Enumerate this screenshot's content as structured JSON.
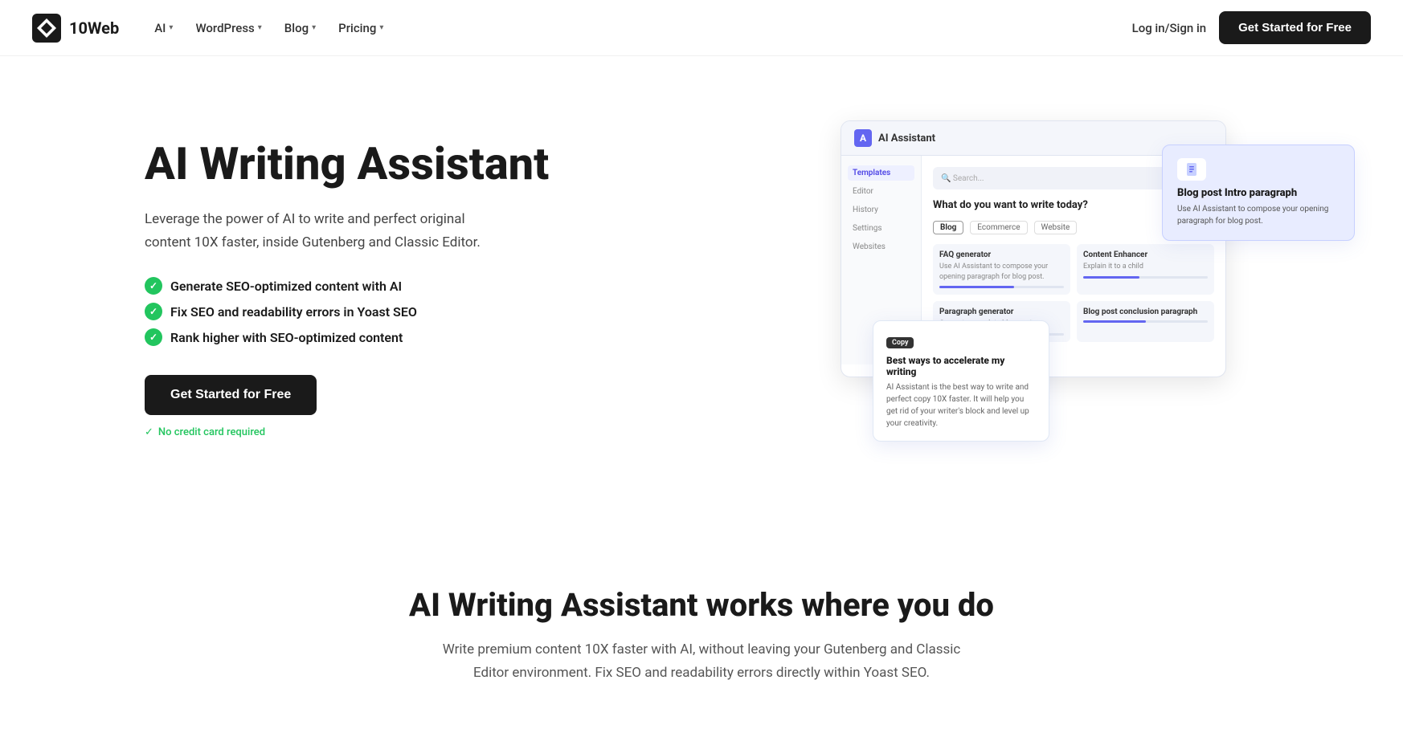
{
  "brand": {
    "name": "10Web",
    "logo_alt": "10Web logo"
  },
  "navbar": {
    "menu": [
      {
        "label": "AI",
        "has_dropdown": true
      },
      {
        "label": "WordPress",
        "has_dropdown": true
      },
      {
        "label": "Blog",
        "has_dropdown": true
      },
      {
        "label": "Pricing",
        "has_dropdown": true
      }
    ],
    "login_label": "Log in/Sign in",
    "cta_label": "Get Started for Free"
  },
  "hero": {
    "title": "AI Writing Assistant",
    "description": "Leverage the power of AI to write and perfect original content 10X faster, inside Gutenberg and Classic Editor.",
    "features": [
      "Generate SEO-optimized content with AI",
      "Fix SEO and readability errors in Yoast SEO",
      "Rank higher with SEO-optimized content"
    ],
    "cta_label": "Get Started for Free",
    "no_cc_label": "No credit card required"
  },
  "mockup": {
    "topbar_title": "AI Assistant",
    "prompt": "What do you want to write today?",
    "search_placeholder": "Search...",
    "sidebar_items": [
      "Templates",
      "Editor",
      "History",
      "Settings",
      "Websites"
    ],
    "tabs": [
      "Blog",
      "Ecommerce",
      "Website"
    ],
    "cards": [
      {
        "title": "FAQ generator",
        "text": "Use AI Assistant to compose your opening paragraph for blog post."
      },
      {
        "title": "Content Enhancer",
        "text": "Explain it to a child"
      },
      {
        "title": "Paragraph generator",
        "text": "Generate complete blog post"
      },
      {
        "title": "Blog post conclusion paragraph",
        "text": ""
      }
    ]
  },
  "floating_card_1": {
    "copy_label": "Copy",
    "title": "Best ways to accelerate my writing",
    "text": "AI Assistant is the best way to write and perfect copy 10X faster. It will help you get rid of your writer's block and level up your creativity."
  },
  "floating_card_2": {
    "title": "Blog post Intro paragraph",
    "text": "Use AI Assistant to compose your opening paragraph for blog post.",
    "icon_label": "document-icon"
  },
  "section2": {
    "title": "AI Writing Assistant works where you do",
    "subtitle": "Write premium content 10X faster with AI, without leaving your Gutenberg and Classic Editor environment. Fix SEO and readability errors directly within Yoast SEO."
  }
}
